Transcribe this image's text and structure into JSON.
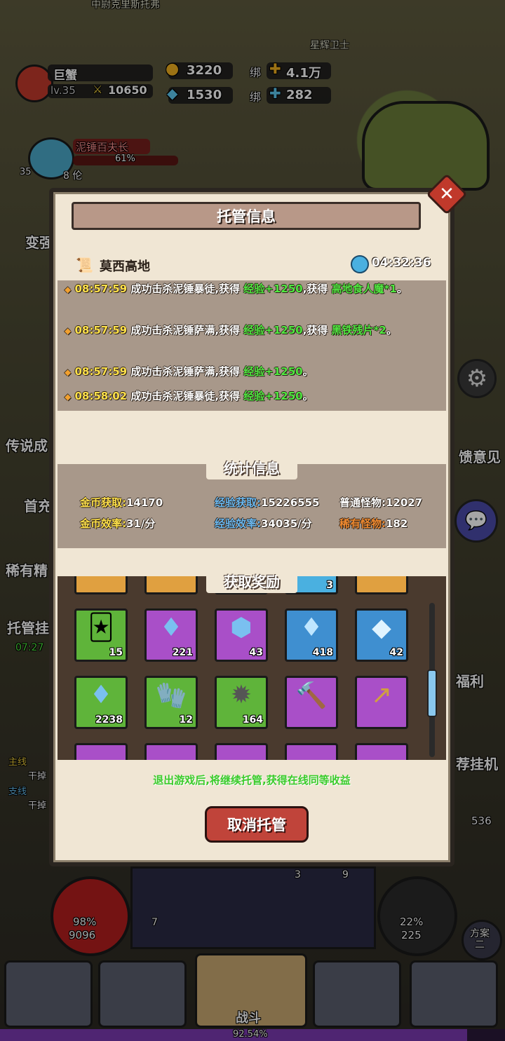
{
  "hud": {
    "top_npc": "中尉克里斯托弗",
    "top_npc2": "星辉卫士",
    "player_name": "巨蟹",
    "player_level": "lv.35",
    "power": "10650",
    "gold": "3220",
    "diamond": "1530",
    "bound_label": "绑",
    "bound_gold": "4.1万",
    "bound_diamond": "282",
    "boss_name": "泥锤百夫长",
    "boss_percent": "61%",
    "left_level": "35",
    "left_count": "8 伦",
    "side_left": [
      "变强",
      "传说成",
      "首充",
      "稀有精",
      "托管挂"
    ],
    "side_left_timer": "07:27",
    "quest_main": "主线",
    "quest_side": "支线",
    "quest_dry": "干掉",
    "side_right": [
      "馈意见",
      "福利",
      "荐挂机"
    ],
    "side_right_count": "536",
    "hp_percent": "98%",
    "hp_value": "9096",
    "mp_percent": "22%",
    "mp_value": "225",
    "plan_label": "方案二",
    "skill_counts": [
      "3",
      "9",
      "7"
    ],
    "battle_label": "战斗",
    "exp_percent": "92.54%"
  },
  "dialog": {
    "title": "托管信息",
    "map_name": "莫西高地",
    "timer": "04:32:36",
    "log": [
      {
        "time": "08:57:59",
        "text": "成功击杀泥锤暴徒,获得",
        "exp": "经验+1250",
        "mid": ",获得",
        "item": "高地食人魔*1",
        "end": "。"
      },
      {
        "time": "08:57:59",
        "text": "成功击杀泥锤萨满,获得",
        "exp": "经验+1250",
        "mid": ",获得",
        "item": "黑铁残片*2",
        "end": "。"
      },
      {
        "time": "08:57:59",
        "text": "成功击杀泥锤萨满,获得",
        "exp": "经验+1250",
        "mid": "",
        "item": "",
        "end": "。"
      },
      {
        "time": "08:58:02",
        "text": "成功击杀泥锤暴徒,获得",
        "exp": "经验+1250",
        "mid": "",
        "item": "",
        "end": "。"
      }
    ],
    "stats_title": "统计信息",
    "stats": {
      "gold_get_label": "金币获取:",
      "gold_get": "14170",
      "exp_get_label": "经验获取:",
      "exp_get": "15226555",
      "normal_label": "普通怪物:",
      "normal": "12027",
      "gold_rate_label": "金币效率:",
      "gold_rate": "31/分",
      "exp_rate_label": "经验效率:",
      "exp_rate": "34035/分",
      "rare_label": "稀有怪物:",
      "rare": "182"
    },
    "rewards_title": "获取奖励",
    "rewards_partial_count": "3",
    "rewards": [
      {
        "count": "15",
        "color": "green",
        "icon": "monster-card-icon"
      },
      {
        "count": "221",
        "color": "purple",
        "icon": "crystal-icon"
      },
      {
        "count": "43",
        "color": "purple",
        "icon": "ore-icon"
      },
      {
        "count": "418",
        "color": "blue",
        "icon": "crystal-icon"
      },
      {
        "count": "42",
        "color": "blue",
        "icon": "gem-icon"
      },
      {
        "count": "2238",
        "color": "green",
        "icon": "crystal-icon"
      },
      {
        "count": "12",
        "color": "green",
        "icon": "cloth-icon"
      },
      {
        "count": "164",
        "color": "green",
        "icon": "spiked-armor-icon"
      },
      {
        "count": "",
        "color": "purple",
        "icon": "mace-icon"
      },
      {
        "count": "",
        "color": "purple",
        "icon": "spear-icon"
      }
    ],
    "footer_note": "退出游戏后,将继续托管,获得在线同等收益",
    "cancel_label": "取消托管"
  }
}
